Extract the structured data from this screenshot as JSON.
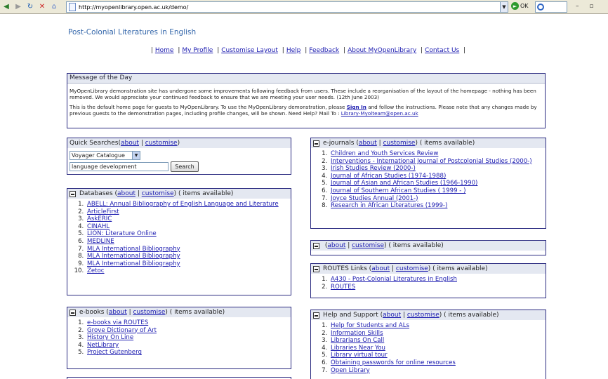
{
  "browser": {
    "url": "http://myopenlibrary.open.ac.uk/demo/",
    "go_label": "OK"
  },
  "site_title": "Post-Colonial Literatures in English",
  "top_nav": [
    "Home",
    "My Profile",
    "Customise Layout",
    "Help",
    "Feedback",
    "About MyOpenLibrary",
    "Contact Us"
  ],
  "motd": {
    "title": "Message of the Day",
    "p1": "MyOpenLibrary demonstration site has undergone some improvements following feedback from users. These include a reorganisation of the layout of the homepage - nothing has been removed. We would appreciate your continued feedback to ensure that we are meeting your user needs. (12th June 2003)",
    "p2_a": "This is the default home page for guests to MyOpenLibrary. To use the MyOpenLibrary demonstration, please ",
    "p2_link": "Sign In",
    "p2_b": " and follow the instructions. Please note that any changes made by previous guests to the demonstration pages, including profile changes, will be shown. Need Help? Mail To : ",
    "p2_mail": "Library-Myolteam@open.ac.uk"
  },
  "quick_search": {
    "title": "Quick Searches",
    "about": "about",
    "customise": "customise",
    "catalogue": "Voyager Catalogue",
    "query": "language development",
    "button": "Search"
  },
  "databases": {
    "title": "Databases",
    "about": "about",
    "customise": "customise",
    "count_text": "( items available)",
    "items": [
      "ABELL: Annual Bibliography of English Language and Literature",
      "ArticleFirst",
      "AskERIC",
      "CINAHL",
      "LION: Literature Online",
      "MEDLINE",
      "MLA International Bibliography",
      "MLA International Bibliography",
      "MLA International Bibliography",
      "Zetoc"
    ]
  },
  "ebooks": {
    "title": "e-books",
    "about": "about",
    "customise": "customise",
    "count_text": "( items available)",
    "items": [
      "e-books via ROUTES",
      "Grove Dictionary of Art",
      "History On Line",
      "NetLibrary",
      "Project Gutenberg"
    ]
  },
  "ejournals": {
    "title": "e-journals",
    "about": "about",
    "customise": "customise",
    "count_text": "( items available)",
    "items": [
      "Children and Youth Services Review",
      "Interventions - International Journal of Postcolonial Studies (2000-)",
      "Irish Studies Review (2000-)",
      "Journal of African Studies (1974-1988)",
      "Journal of Asian and African Studies (1966-1990)",
      "Journal of Southern African Studies ( 1999 - )",
      "Joyce Studies Annual (2001-)",
      "Research in African Literatures (1999-)"
    ]
  },
  "blank_box": {
    "about": "about",
    "customise": "customise",
    "count_text": "( items available)"
  },
  "routes": {
    "title": "ROUTES Links",
    "about": "about",
    "customise": "customise",
    "count_text": "( items available)",
    "items": [
      "A430 - Post-Colonial Literatures in English",
      "ROUTES"
    ]
  },
  "help": {
    "title": "Help and Support",
    "about": "about",
    "customise": "customise",
    "count_text": "( items available)",
    "items": [
      "Help for Students and ALs",
      "Information Skills",
      "Librarians On Call",
      "Libraries Near You",
      "Library virtual tour",
      "Obtaining passwords for online resources",
      "Open Library"
    ]
  }
}
